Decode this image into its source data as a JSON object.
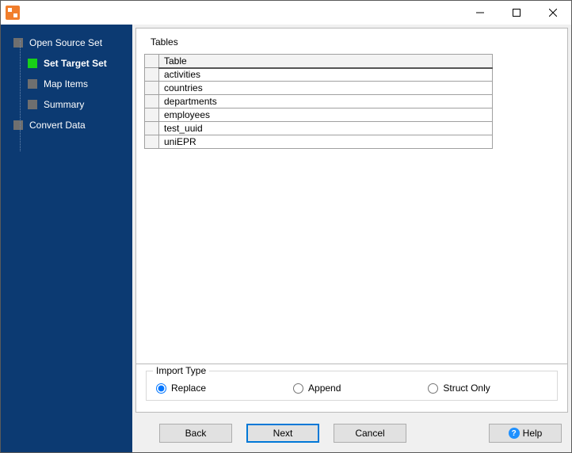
{
  "sidebar": {
    "steps": [
      {
        "id": "open-source-set",
        "label": "Open Source Set",
        "child": false,
        "current": false
      },
      {
        "id": "set-target-set",
        "label": "Set Target Set",
        "child": true,
        "current": true
      },
      {
        "id": "map-items",
        "label": "Map Items",
        "child": true,
        "current": false
      },
      {
        "id": "summary",
        "label": "Summary",
        "child": true,
        "current": false
      },
      {
        "id": "convert-data",
        "label": "Convert Data",
        "child": false,
        "current": false
      }
    ]
  },
  "main": {
    "panel_title": "Tables",
    "table_header": "Table",
    "tables": [
      "activities",
      "countries",
      "departments",
      "employees",
      "test_uuid",
      "uniEPR"
    ],
    "import_type": {
      "legend": "Import Type",
      "options": [
        {
          "id": "replace",
          "label": "Replace",
          "checked": true
        },
        {
          "id": "append",
          "label": "Append",
          "checked": false
        },
        {
          "id": "struct",
          "label": "Struct Only",
          "checked": false
        }
      ]
    }
  },
  "buttons": {
    "back": "Back",
    "next": "Next",
    "cancel": "Cancel",
    "help": "Help"
  }
}
